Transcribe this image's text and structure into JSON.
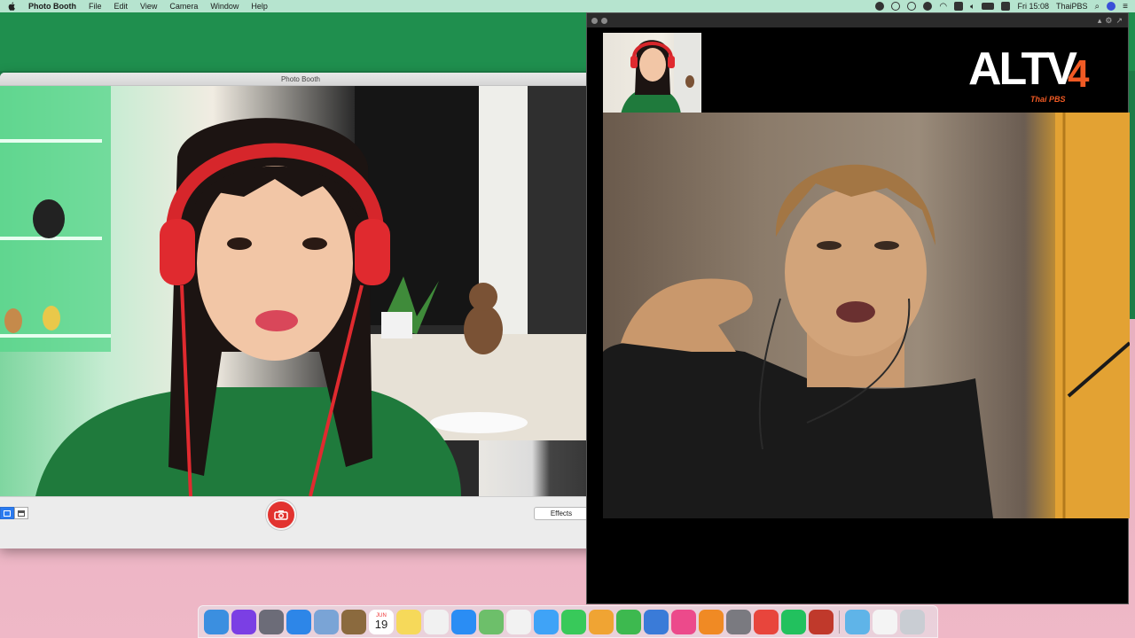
{
  "menubar": {
    "app_name": "Photo Booth",
    "menus": [
      "File",
      "Edit",
      "View",
      "Camera",
      "Window",
      "Help"
    ],
    "clock": "Fri 15:08",
    "user": "ThaiPBS"
  },
  "photobooth": {
    "title": "Photo Booth",
    "effects_label": "Effects"
  },
  "logo": {
    "text": "ALTV",
    "number": "4",
    "sub": "Thai PBS"
  },
  "colors": {
    "accent_shutter": "#e2332f",
    "logo_orange": "#f05a24",
    "menubar_bg": "#b6e4cf"
  },
  "dock": {
    "icons": [
      {
        "name": "finder-icon",
        "color": "#3b8fe0"
      },
      {
        "name": "siri-icon",
        "color": "#7b3fe4"
      },
      {
        "name": "launchpad-icon",
        "color": "#6c6c78"
      },
      {
        "name": "safari-icon",
        "color": "#2d86e8"
      },
      {
        "name": "mail-icon",
        "color": "#7aa4d6"
      },
      {
        "name": "notes-book-icon",
        "color": "#8b6a3e"
      },
      {
        "name": "calendar-icon",
        "color": "#ffffff"
      },
      {
        "name": "notes-icon",
        "color": "#f6d95a"
      },
      {
        "name": "reminders-icon",
        "color": "#f1f1f1"
      },
      {
        "name": "app-store-icon",
        "color": "#2a8df4"
      },
      {
        "name": "maps-icon",
        "color": "#6dbf6a"
      },
      {
        "name": "photos-icon",
        "color": "#f2f2f2"
      },
      {
        "name": "messages-icon",
        "color": "#3fa3f7"
      },
      {
        "name": "facetime-icon",
        "color": "#38c95a"
      },
      {
        "name": "pages-icon",
        "color": "#f0a433"
      },
      {
        "name": "numbers-icon",
        "color": "#3db94f"
      },
      {
        "name": "keynote-icon",
        "color": "#3a7bd8"
      },
      {
        "name": "itunes-icon",
        "color": "#ec4a8b"
      },
      {
        "name": "books-icon",
        "color": "#f08a24"
      },
      {
        "name": "system-preferences-icon",
        "color": "#7a7a80"
      },
      {
        "name": "chrome-icon",
        "color": "#e8453c"
      },
      {
        "name": "line-icon",
        "color": "#22c15e"
      },
      {
        "name": "photo-booth-icon",
        "color": "#c0392b"
      },
      {
        "name": "downloads-folder-icon",
        "color": "#5fb4e8"
      },
      {
        "name": "document-icon",
        "color": "#f4f4f4"
      },
      {
        "name": "trash-icon",
        "color": "#c9cdd3"
      }
    ],
    "calendar_day": "19",
    "calendar_month": "JUN"
  }
}
